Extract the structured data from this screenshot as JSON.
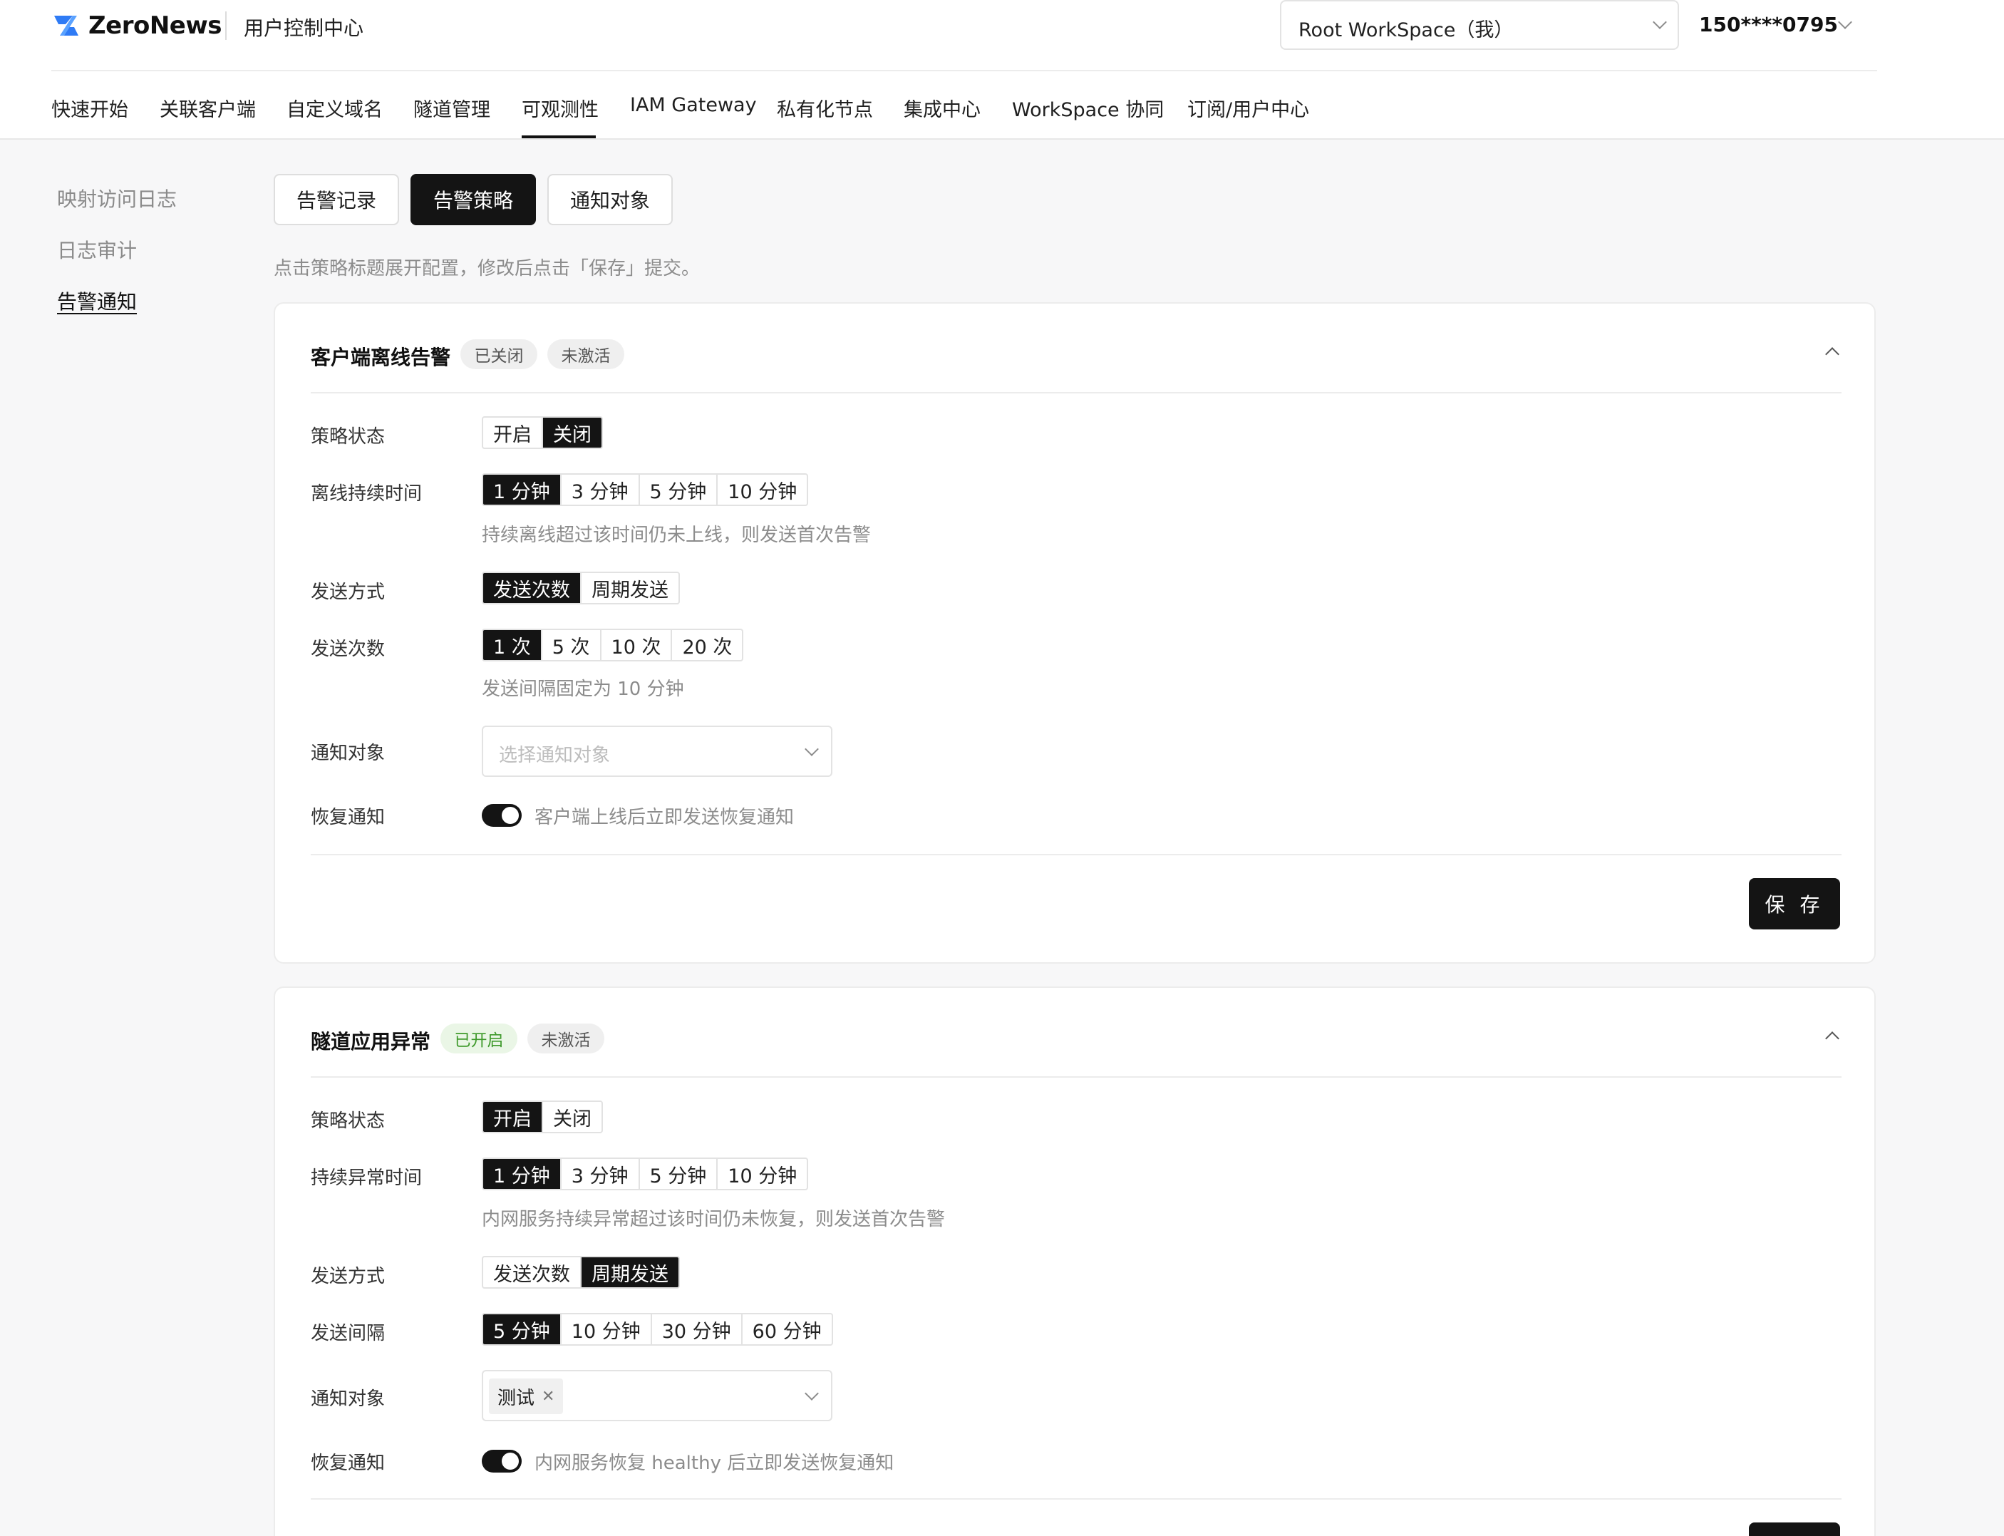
{
  "header": {
    "brand": "ZeroNews",
    "console_title": "用户控制中心",
    "workspace": "Root WorkSpace（我）",
    "user_phone": "150****0795"
  },
  "nav": {
    "items": [
      "快速开始",
      "关联客户端",
      "自定义域名",
      "隧道管理",
      "可观测性",
      "IAM Gateway",
      "私有化节点",
      "集成中心",
      "WorkSpace 协同",
      "订阅/用户中心"
    ],
    "active": "可观测性"
  },
  "side_menu": {
    "items": [
      "映射访问日志",
      "日志审计",
      "告警通知"
    ],
    "active": "告警通知"
  },
  "tabs": {
    "items": [
      "告警记录",
      "告警策略",
      "通知对象"
    ],
    "active": "告警策略"
  },
  "hint": "点击策略标题展开配置，修改后点击「保存」提交。",
  "colors": {
    "primary": "#141414",
    "enabled_green": "#3f9a2c"
  },
  "cards": [
    {
      "title": "客户端离线告警",
      "badges": [
        "已关闭",
        "未激活"
      ],
      "status_label": "策略状态",
      "status_options": [
        "开启",
        "关闭"
      ],
      "status_selected": "关闭",
      "duration_label": "离线持续时间",
      "duration_options": [
        "1 分钟",
        "3 分钟",
        "5 分钟",
        "10 分钟"
      ],
      "duration_selected": "1 分钟",
      "duration_help": "持续离线超过该时间仍未上线，则发送首次告警",
      "method_label": "发送方式",
      "method_options": [
        "发送次数",
        "周期发送"
      ],
      "method_selected": "发送次数",
      "count_label": "发送次数",
      "count_options": [
        "1 次",
        "5 次",
        "10 次",
        "20 次"
      ],
      "count_selected": "1 次",
      "count_help": "发送间隔固定为 10 分钟",
      "target_label": "通知对象",
      "target_placeholder": "选择通知对象",
      "recovery_label": "恢复通知",
      "recovery_on": true,
      "recovery_text": "客户端上线后立即发送恢复通知",
      "save_label": "保 存"
    },
    {
      "title": "隧道应用异常",
      "badges": [
        "已开启",
        "未激活"
      ],
      "status_label": "策略状态",
      "status_options": [
        "开启",
        "关闭"
      ],
      "status_selected": "开启",
      "duration_label": "持续异常时间",
      "duration_options": [
        "1 分钟",
        "3 分钟",
        "5 分钟",
        "10 分钟"
      ],
      "duration_selected": "1 分钟",
      "duration_help": "内网服务持续异常超过该时间仍未恢复，则发送首次告警",
      "method_label": "发送方式",
      "method_options": [
        "发送次数",
        "周期发送"
      ],
      "method_selected": "周期发送",
      "interval_label": "发送间隔",
      "interval_options": [
        "5 分钟",
        "10 分钟",
        "30 分钟",
        "60 分钟"
      ],
      "interval_selected": "5 分钟",
      "target_label": "通知对象",
      "target_tags": [
        "测试"
      ],
      "recovery_label": "恢复通知",
      "recovery_on": true,
      "recovery_text": "内网服务恢复 healthy 后立即发送恢复通知"
    }
  ]
}
